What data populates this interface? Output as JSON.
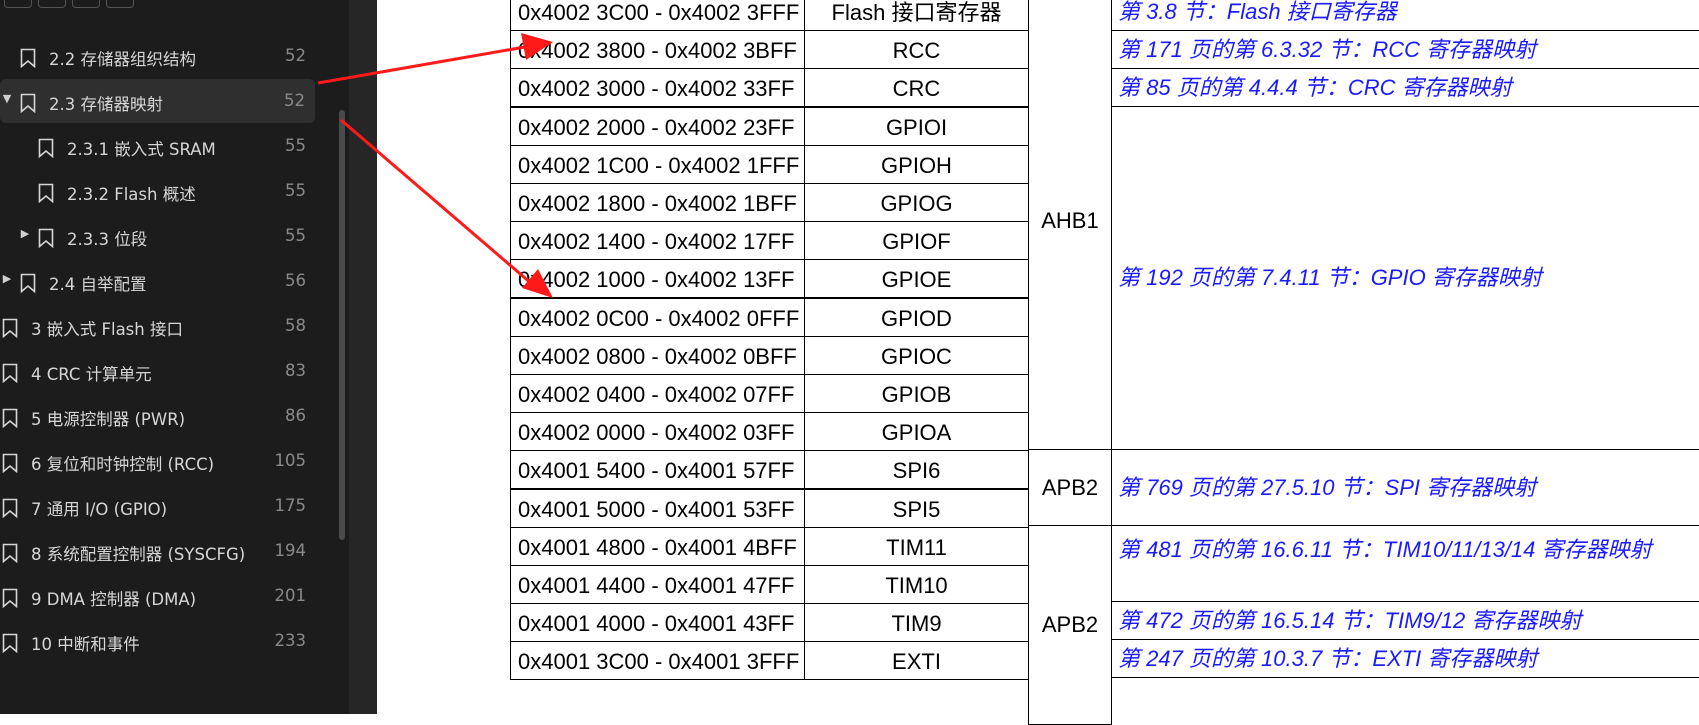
{
  "sidebar": {
    "items": [
      {
        "label": "2.2 存储器组织结构",
        "page": "52"
      },
      {
        "label": "2.3 存储器映射",
        "page": "52"
      },
      {
        "label": "2.3.1 嵌入式 SRAM",
        "page": "55"
      },
      {
        "label": "2.3.2 Flash 概述",
        "page": "55"
      },
      {
        "label": "2.3.3 位段",
        "page": "55"
      },
      {
        "label": "2.4 自举配置",
        "page": "56"
      },
      {
        "label": "3 嵌入式 Flash 接口",
        "page": "58"
      },
      {
        "label": "4 CRC 计算单元",
        "page": "83"
      },
      {
        "label": "5 电源控制器 (PWR)",
        "page": "86"
      },
      {
        "label": "6 复位和时钟控制 (RCC)",
        "page": "105"
      },
      {
        "label": "7 通用 I/O (GPIO)",
        "page": "175"
      },
      {
        "label": "8 系统配置控制器 (SYSCFG)",
        "page": "194"
      },
      {
        "label": "9 DMA 控制器 (DMA)",
        "page": "201"
      },
      {
        "label": "10 中断和事件",
        "page": "233"
      }
    ]
  },
  "table": {
    "rows": [
      {
        "range": "0x4002 3C00 - 0x4002 3FFF",
        "peripheral": "Flash 接口寄存器"
      },
      {
        "range": "0x4002 3800 - 0x4002 3BFF",
        "peripheral": "RCC"
      },
      {
        "range": "0x4002 3000 - 0x4002 33FF",
        "peripheral": "CRC"
      },
      {
        "range": "0x4002 2000 - 0x4002 23FF",
        "peripheral": "GPIOI"
      },
      {
        "range": "0x4002 1C00 - 0x4002 1FFF",
        "peripheral": "GPIOH"
      },
      {
        "range": "0x4002 1800 - 0x4002 1BFF",
        "peripheral": "GPIOG"
      },
      {
        "range": "0x4002 1400 - 0x4002 17FF",
        "peripheral": "GPIOF"
      },
      {
        "range": "0x4002 1000 - 0x4002 13FF",
        "peripheral": "GPIOE"
      },
      {
        "range": "0x4002 0C00 - 0x4002 0FFF",
        "peripheral": "GPIOD"
      },
      {
        "range": "0x4002 0800 - 0x4002 0BFF",
        "peripheral": "GPIOC"
      },
      {
        "range": "0x4002 0400 - 0x4002 07FF",
        "peripheral": "GPIOB"
      },
      {
        "range": "0x4002 0000 - 0x4002 03FF",
        "peripheral": "GPIOA"
      },
      {
        "range": "0x4001 5400 - 0x4001 57FF",
        "peripheral": "SPI6"
      },
      {
        "range": "0x4001 5000 - 0x4001 53FF",
        "peripheral": "SPI5"
      },
      {
        "range": "0x4001 4800 - 0x4001 4BFF",
        "peripheral": "TIM11"
      },
      {
        "range": "0x4001 4400 - 0x4001 47FF",
        "peripheral": "TIM10"
      },
      {
        "range": "0x4001 4000 - 0x4001 43FF",
        "peripheral": "TIM9"
      },
      {
        "range": "0x4001 3C00 - 0x4001 3FFF",
        "peripheral": "EXTI"
      }
    ],
    "buses": {
      "ahb1": "AHB1",
      "apb2_a": "APB2",
      "apb2_b": "APB2"
    },
    "refs": {
      "flash": "第 3.8 节：Flash 接口寄存器",
      "rcc": "第 171 页的第 6.3.32 节：RCC 寄存器映射",
      "crc": "第 85 页的第 4.4.4 节：CRC 寄存器映射",
      "gpio": "第 192 页的第 7.4.11 节：GPIO 寄存器映射",
      "spi": "第 769 页的第 27.5.10 节：SPI 寄存器映射",
      "tim10": "第 481 页的第 16.6.11 节：TIM10/11/13/14 寄存器映射",
      "tim9": "第 472 页的第 16.5.14 节：TIM9/12 寄存器映射",
      "exti": "第 247 页的第 10.3.7 节：EXTI 寄存器映射"
    }
  },
  "colors": {
    "sidebar_bg": "#1c1c1c",
    "sidebar_text": "#d6d6d6",
    "link_blue": "#1a1aff",
    "arrow_red": "#ff1a1a"
  }
}
